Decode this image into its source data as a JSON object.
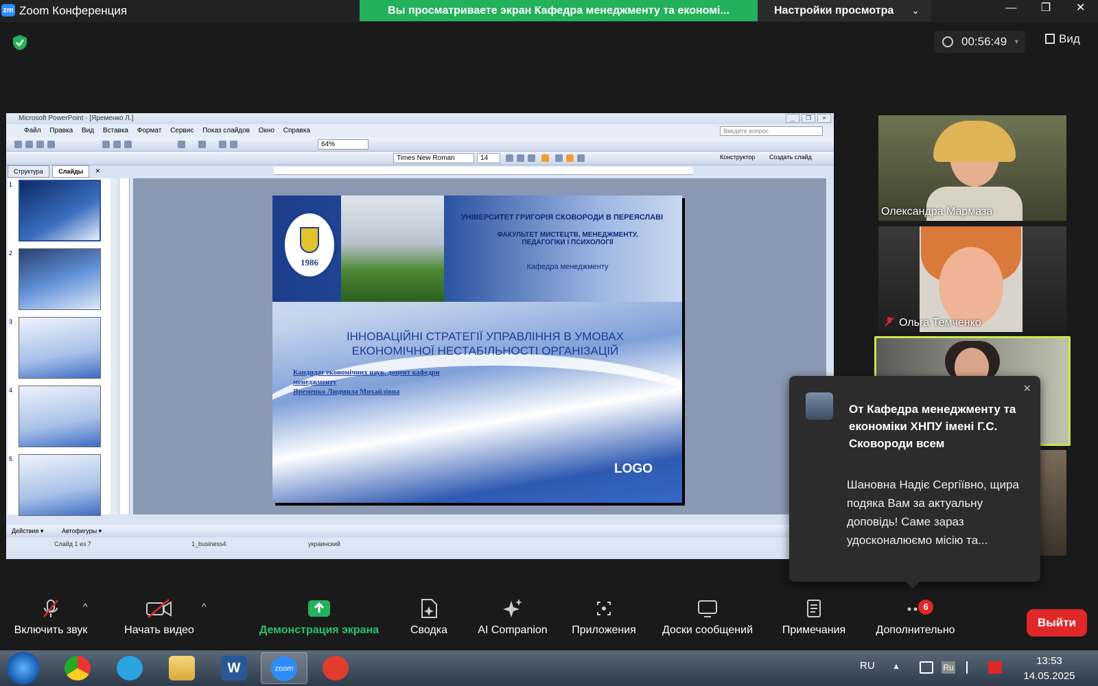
{
  "app": {
    "logo": "zm",
    "title": "Zoom Конференция"
  },
  "share_banner": "Вы просматриваете экран Кафедра менеджменту та економі...",
  "view_options": {
    "label": "Настройки просмотра",
    "chevron": "⌄"
  },
  "window_controls": {
    "minimize": "—",
    "maximize": "❐",
    "close": "✕"
  },
  "timer": {
    "time": "00:56:49",
    "dropdown": "▾"
  },
  "view_button": {
    "label": "Вид"
  },
  "ppt": {
    "title": "Microsoft PowerPoint - [Яременко Л.]",
    "window_controls": {
      "minimize": "_",
      "restore": "❐",
      "close": "×"
    },
    "menu": [
      "Файл",
      "Правка",
      "Вид",
      "Вставка",
      "Формат",
      "Сервис",
      "Показ слайдов",
      "Окно",
      "Справка"
    ],
    "ask_placeholder": "Введите вопрос",
    "zoom": "64%",
    "font_name": "Times New Roman",
    "font_size": "14",
    "constructor": "Конструктор",
    "create_slide": "Создать слайд",
    "tabs": [
      "Структура",
      "Слайды"
    ],
    "pane_close": "×",
    "thumbnail_numbers": [
      "1",
      "2",
      "3",
      "4",
      "5"
    ],
    "slide": {
      "year": "1986",
      "university": "УНІВЕРСИТЕТ ГРИГОРІЯ СКОВОРОДИ В ПЕРЕЯСЛАВІ",
      "faculty_line1": "ФАКУЛЬТЕТ МИСТЕЦТВ, МЕНЕДЖМЕНТУ,",
      "faculty_line2": "ПЕДАГОГІКИ І ПСИХОЛОГІЇ",
      "department": "Кафедра менеджменту",
      "title_line1": "ІННОВАЦІЙНІ СТРАТЕГІЇ УПРАВЛІННЯ В УМОВАХ",
      "title_line2": "ЕКОНОМІЧНОЇ НЕСТАБІЛЬНОСТІ ОРГАНІЗАЦІЙ",
      "author_line1": "Кандидат економічних наук, доцент кафедри",
      "author_line2": "менеджменту",
      "author_line3": "Яременко Людмила Михайлівна",
      "logo": "LOGO"
    },
    "drawbar": {
      "actions": "Действия ▾",
      "autoshapes": "Автофигуры ▾"
    },
    "status": {
      "slide": "Слайд 1 из 7",
      "design": "1_business4",
      "language": "украинский"
    }
  },
  "participants": [
    {
      "name": "Олександра Мармаза",
      "muted": false
    },
    {
      "name": "Ольга Темченко",
      "muted": true
    }
  ],
  "notification": {
    "from": "От Кафедра менеджменту та економіки ХНПУ імені Г.С. Сковороди всем",
    "message": "Шановна Надіє Сергіївно, щира подяка Вам за актуальну доповідь! Саме зараз удосконалюємо місію та...",
    "close": "×"
  },
  "controls": {
    "unmute": "Включить звук",
    "start_video": "Начать видео",
    "share_screen": "Демонстрация экрана",
    "summary": "Сводка",
    "ai_companion": "AI Companion",
    "apps": "Приложения",
    "whiteboards": "Доски сообщений",
    "notes": "Примечания",
    "more": "Дополнительно",
    "more_badge": "6",
    "leave": "Выйти",
    "caret": "^"
  },
  "taskbar": {
    "language": "RU",
    "tray_lang": "Ru",
    "tray_arrow": "▲",
    "time": "13:53",
    "date": "14.05.2025",
    "zoom_label": "zoom",
    "word_label": "W"
  },
  "colors": {
    "zoom_green": "#23b15b",
    "leave_red": "#e02828",
    "badge_red": "#e02828",
    "active_speaker": "#c8e84a"
  }
}
